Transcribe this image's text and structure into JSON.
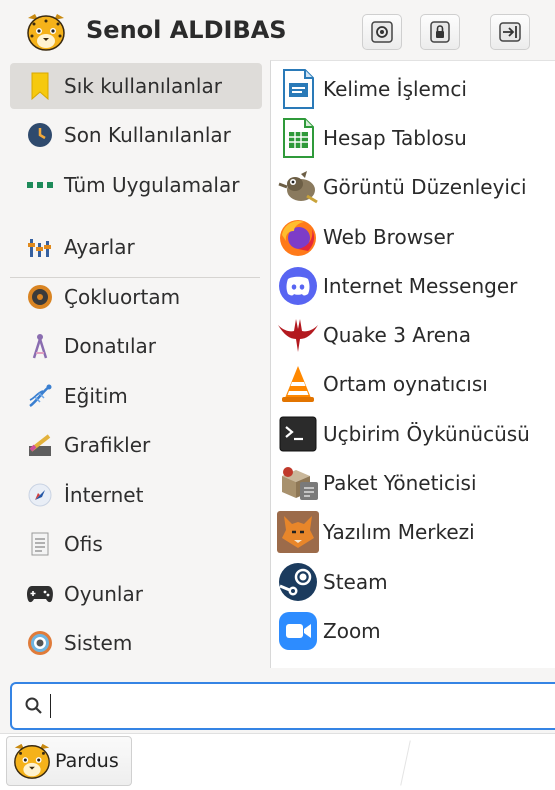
{
  "header": {
    "username": "Senol ALDIBAS",
    "buttons": [
      {
        "icon": "settings-icon"
      },
      {
        "icon": "lock-icon"
      },
      {
        "icon": "logout-icon"
      }
    ]
  },
  "categories": [
    {
      "label": "Sık kullanılanlar",
      "icon": "bookmark-icon",
      "active": true
    },
    {
      "label": "Son Kullanılanlar",
      "icon": "clock-icon"
    },
    {
      "label": "Tüm Uygulamalar",
      "icon": "apps-grid-icon"
    },
    {
      "label": "Ayarlar",
      "icon": "sliders-icon"
    },
    {
      "label": "Çokluortam",
      "icon": "multimedia-icon"
    },
    {
      "label": "Donatılar",
      "icon": "compass-icon"
    },
    {
      "label": "Eğitim",
      "icon": "dna-icon"
    },
    {
      "label": "Grafikler",
      "icon": "graphics-icon"
    },
    {
      "label": "İnternet",
      "icon": "globe-icon"
    },
    {
      "label": "Ofis",
      "icon": "document-icon"
    },
    {
      "label": "Oyunlar",
      "icon": "gamepad-icon"
    },
    {
      "label": "Sistem",
      "icon": "system-icon"
    }
  ],
  "apps": [
    {
      "label": "Kelime İşlemci",
      "icon": "writer-icon"
    },
    {
      "label": "Hesap Tablosu",
      "icon": "calc-icon"
    },
    {
      "label": "Görüntü Düzenleyici",
      "icon": "gimp-icon"
    },
    {
      "label": "Web Browser",
      "icon": "firefox-icon"
    },
    {
      "label": "Internet Messenger",
      "icon": "discord-icon"
    },
    {
      "label": "Quake 3 Arena",
      "icon": "quake-icon"
    },
    {
      "label": "Ortam oynatıcısı",
      "icon": "vlc-icon"
    },
    {
      "label": "Uçbirim Öykünücüsü",
      "icon": "terminal-icon"
    },
    {
      "label": "Paket Yöneticisi",
      "icon": "package-manager-icon"
    },
    {
      "label": "Yazılım Merkezi",
      "icon": "software-center-icon"
    },
    {
      "label": "Steam",
      "icon": "steam-icon"
    },
    {
      "label": "Zoom",
      "icon": "zoom-icon"
    }
  ],
  "search": {
    "value": "",
    "placeholder": ""
  },
  "taskbar": {
    "start_label": "Pardus"
  },
  "colors": {
    "accent": "#3584e4",
    "selected_bg": "#dedcd9"
  }
}
